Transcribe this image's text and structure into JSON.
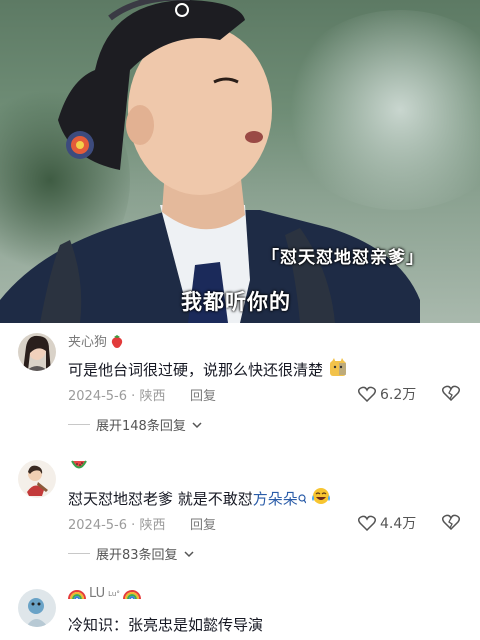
{
  "video": {
    "caption_tag": "「怼天怼地怼亲爹」",
    "caption_main": "我都听你的"
  },
  "comments": [
    {
      "username": "夹心狗",
      "username_emoji": "strawberry-icon",
      "text": "可是他台词很过硬，说那么快还很清楚",
      "text_emoji": "cat-emoji-icon",
      "date": "2024-5-6",
      "location": "陕西",
      "reply_label": "回复",
      "likes": "6.2万",
      "expand_label": "展开148条回复"
    },
    {
      "username": "",
      "username_emoji": "watermelon-icon",
      "text_part1": "怼天怼地怼老爹   就是不敢怼",
      "text_link": "方朵朵",
      "text_emoji": "crying-laugh-icon",
      "date": "2024-5-6",
      "location": "陕西",
      "reply_label": "回复",
      "likes": "4.4万",
      "expand_label": "展开83条回复"
    },
    {
      "username": "LU",
      "username_sup": "Lu°",
      "username_emoji": "rainbow-icon",
      "text": "冷知识：张亮忠是如懿传导演"
    }
  ],
  "colors": {
    "link": "#2a5ca8",
    "meta": "#9b9b9b",
    "text": "#161823"
  }
}
